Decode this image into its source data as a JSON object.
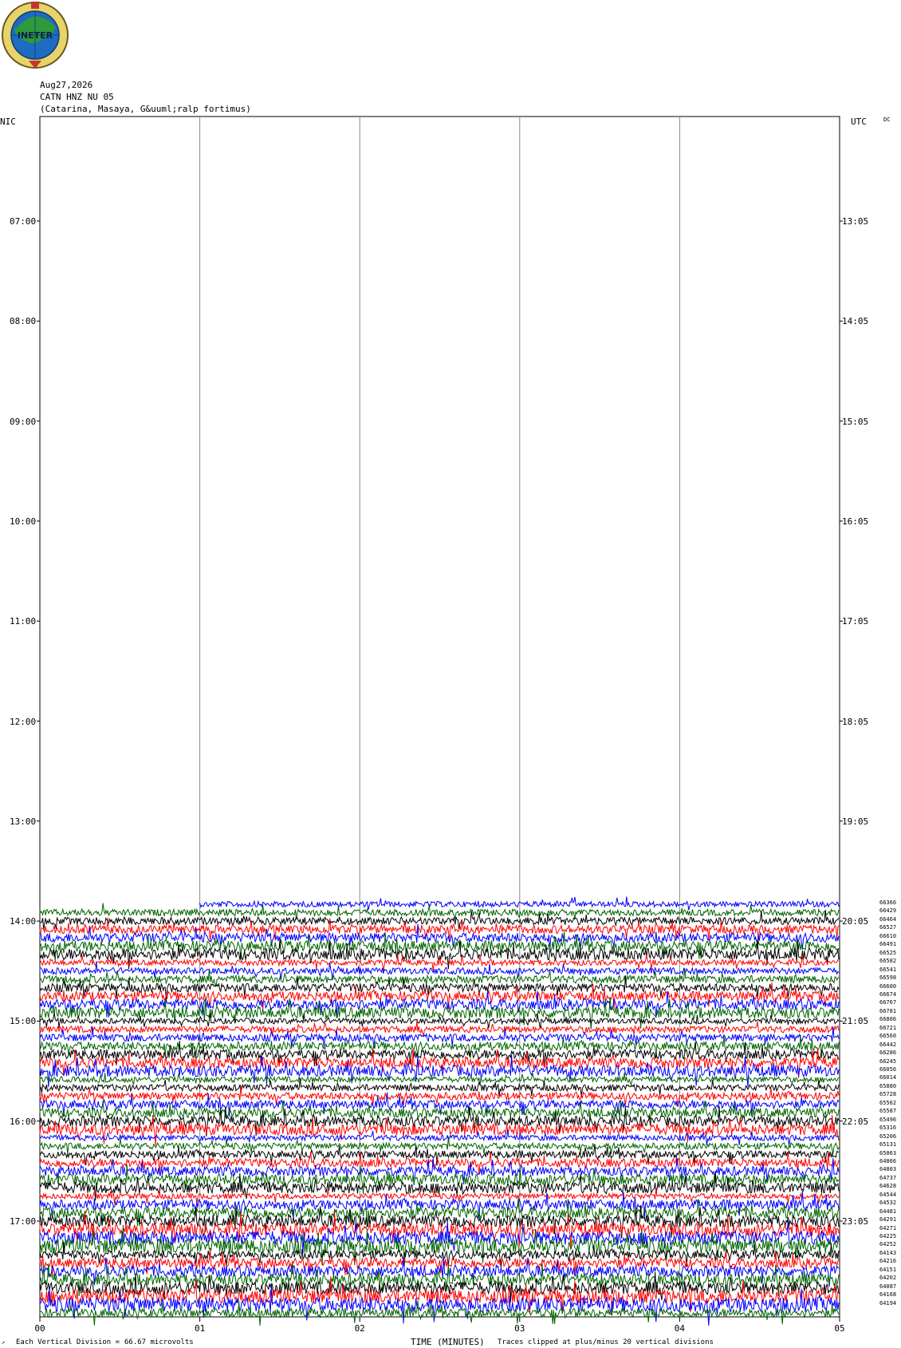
{
  "logo": {
    "text": "INETER",
    "icon": "ineter-logo-icon",
    "colors": [
      "#2e9a3a",
      "#e8d36a",
      "#1e6bbf",
      "#c0392b"
    ]
  },
  "header": {
    "date": "Aug27,2026",
    "station": "CATN HNZ NU 05",
    "location": "(Catarina, Masaya, G&uuml;ralp fortimus)",
    "left_tz": "NIC",
    "right_tz": "UTC",
    "dc_label": "DC"
  },
  "footer": {
    "division": "Each Vertical Division =",
    "microvolts": "66.67 microvolts",
    "xlabel": "TIME (MINUTES)",
    "clip_note": "Traces clipped at plus/minus 20 vertical divisions"
  },
  "chart_data": {
    "type": "line",
    "title": "CATN HNZ NU 05",
    "xlabel": "TIME (MINUTES)",
    "ylabel": "",
    "x_ticks": [
      "00",
      "01",
      "02",
      "03",
      "04",
      "05"
    ],
    "xlim": [
      0,
      5
    ],
    "local_time_labels": [
      "07:00",
      "08:00",
      "09:00",
      "10:00",
      "11:00",
      "12:00",
      "13:00",
      "14:00",
      "15:00",
      "16:00",
      "17:00"
    ],
    "utc_time_labels": [
      "13:05",
      "14:05",
      "15:05",
      "16:05",
      "17:05",
      "18:05",
      "19:05",
      "20:05",
      "21:05",
      "22:05",
      "23:05"
    ],
    "trace_colors": [
      "#0000ff",
      "#006400",
      "#000000",
      "#ff0000"
    ],
    "trace_color_order": [
      "blue",
      "green",
      "black",
      "red"
    ],
    "traces_start_index": 0,
    "trace_count": 50,
    "rms_values": [
      66366,
      66429,
      66464,
      66527,
      66610,
      66491,
      66525,
      66582,
      66541,
      66598,
      66600,
      66674,
      66767,
      66781,
      66806,
      66721,
      66560,
      66442,
      66286,
      66245,
      66056,
      66014,
      65880,
      65728,
      65562,
      65587,
      65496,
      65316,
      65206,
      65131,
      65063,
      64866,
      64803,
      64737,
      64628,
      64544,
      64532,
      64481,
      64291,
      64271,
      64225,
      64252,
      64143,
      64216,
      64151,
      64202,
      64087,
      64168,
      64194,
      64194
    ],
    "grid": true
  }
}
